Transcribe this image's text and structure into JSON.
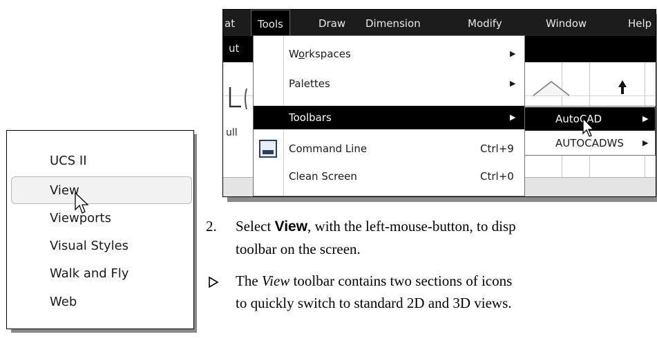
{
  "menubar": {
    "items": [
      "at",
      "Tools",
      "Draw",
      "Dimension",
      "Modify",
      "Window",
      "Help"
    ],
    "active": "Tools"
  },
  "subbar": {
    "label": "ut"
  },
  "left_fragments": [
    "ull"
  ],
  "tools_menu": {
    "items": [
      {
        "label": "Workspaces",
        "access_key": "o",
        "shortcut": "",
        "submenu": true
      },
      {
        "label": "Palettes",
        "shortcut": "",
        "submenu": true
      },
      {
        "label": "Toolbars",
        "shortcut": "",
        "submenu": true,
        "highlighted": true
      },
      {
        "label": "Command Line",
        "shortcut": "Ctrl+9",
        "submenu": false,
        "icon": "command-line-icon"
      },
      {
        "label": "Clean Screen",
        "shortcut": "Ctrl+0",
        "submenu": false
      }
    ]
  },
  "toolbars_submenu": {
    "items": [
      {
        "label": "AutoCAD",
        "highlighted": true
      },
      {
        "label": "AUTOCADWS"
      }
    ]
  },
  "toolbar_list": {
    "items": [
      "UCS II",
      "View",
      "Viewports",
      "Visual Styles",
      "Walk and Fly",
      "Web"
    ],
    "selected": "View"
  },
  "instructions": {
    "step_number": "2.",
    "step_pre": "Select ",
    "step_bold": "View",
    "step_post": ", with the left-mouse-button, to disp",
    "step_line2": "toolbar on the screen.",
    "note_italic": "View",
    "note_pre": "The ",
    "note_post": " toolbar contains two sections of icons",
    "note_line2": "to quickly switch to standard 2D and 3D views."
  },
  "colors": {
    "menubar_bg": "#1c1c1c",
    "highlight_bg": "#000000",
    "shadow": "#8a8a8a"
  }
}
